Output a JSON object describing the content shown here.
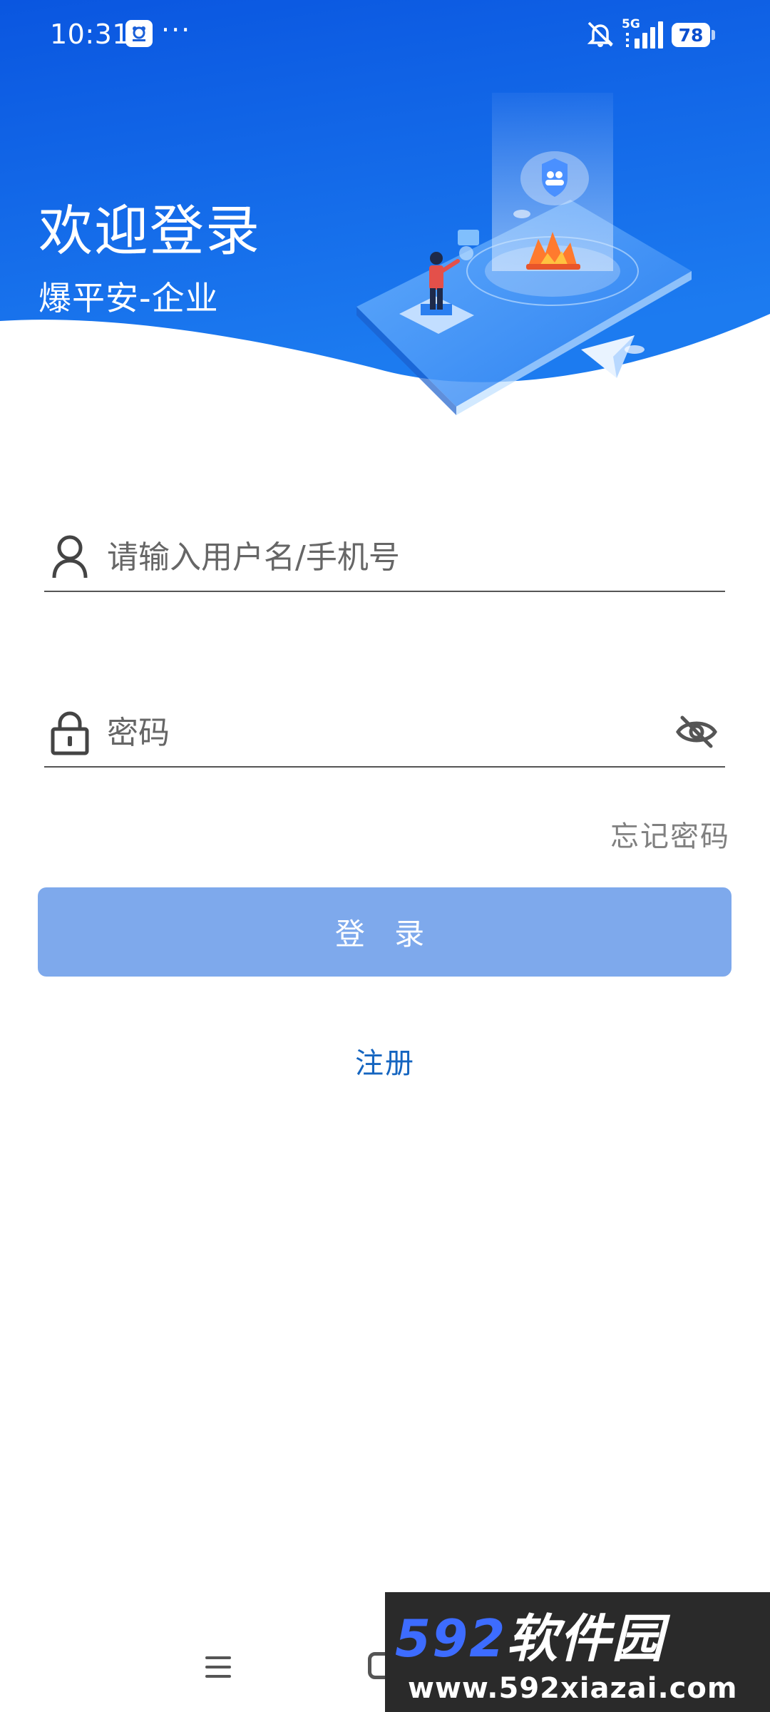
{
  "status_bar": {
    "time": "10:31",
    "dots": "···",
    "network": "5G",
    "battery": "78",
    "icons": [
      "app-notification-icon",
      "mute-icon",
      "signal-icon",
      "battery-icon"
    ]
  },
  "header": {
    "title": "欢迎登录",
    "subtitle": "爆平安-企业"
  },
  "form": {
    "username_placeholder": "请输入用户名/手机号",
    "password_placeholder": "密码",
    "forgot_password": "忘记密码",
    "login_button": "登 录",
    "register_link": "注册"
  },
  "navigation_bar": {
    "icons": [
      "menu-icon",
      "home-icon"
    ]
  },
  "watermark": {
    "number": "592",
    "brand": "软件园",
    "url": "www.592xiazai.com"
  },
  "colors": {
    "primary_blue": "#0b63e5",
    "button_disabled": "#7ea9ec",
    "link_blue": "#1565c0",
    "text_gray": "#808080"
  }
}
